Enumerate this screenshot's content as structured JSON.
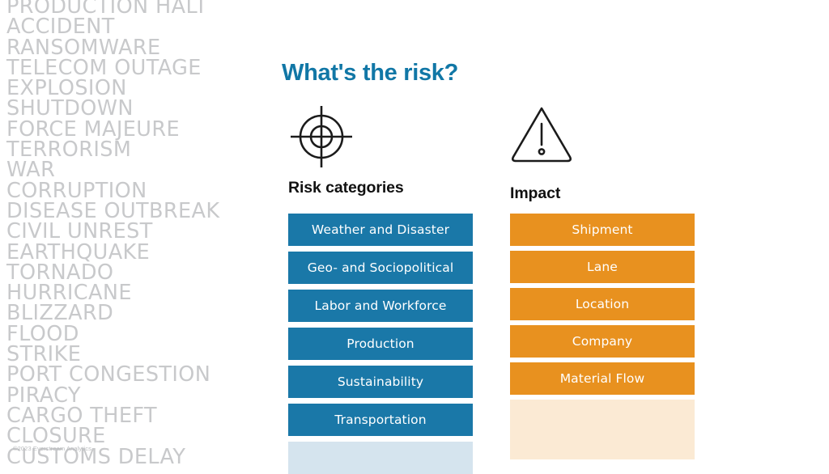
{
  "page": {
    "title": "What's the risk?",
    "copyright": "©2023 Everstream Analytics"
  },
  "background_word_list": {
    "name": "risk-event-words",
    "words": [
      "PRODUCTION HALT",
      "ACCIDENT",
      "RANSOMWARE",
      "TELECOM OUTAGE",
      "EXPLOSION",
      "SHUTDOWN",
      "FORCE MAJEURE",
      "TERRORISM",
      "WAR",
      "CORRUPTION",
      "DISEASE OUTBREAK",
      "CIVIL UNREST",
      "EARTHQUAKE",
      "TORNADO",
      "HURRICANE",
      "BLIZZARD",
      "FLOOD",
      "STRIKE",
      "PORT CONGESTION",
      "PIRACY",
      "CARGO THEFT",
      "CLOSURE",
      "CUSTOMS DELAY"
    ]
  },
  "columns": {
    "risk_categories": {
      "icon": "target-crosshair-icon",
      "heading": "Risk categories",
      "accent_color": "#1a78a8",
      "faded_color": "#d5e4ee",
      "items": [
        "Weather and Disaster",
        "Geo- and Sociopolitical",
        "Labor and Workforce",
        "Production",
        "Sustainability",
        "Transportation"
      ]
    },
    "impact": {
      "icon": "warning-triangle-icon",
      "heading": "Impact",
      "accent_color": "#e8911f",
      "faded_color": "#fbead4",
      "items": [
        "Shipment",
        "Lane",
        "Location",
        "Company",
        "Material Flow"
      ]
    }
  },
  "colors": {
    "title_blue": "#1177a6",
    "chip_blue": "#1a78a8",
    "chip_orange": "#e8911f",
    "word_list_grey": "#c8c9cb",
    "background": "#ffffff"
  }
}
